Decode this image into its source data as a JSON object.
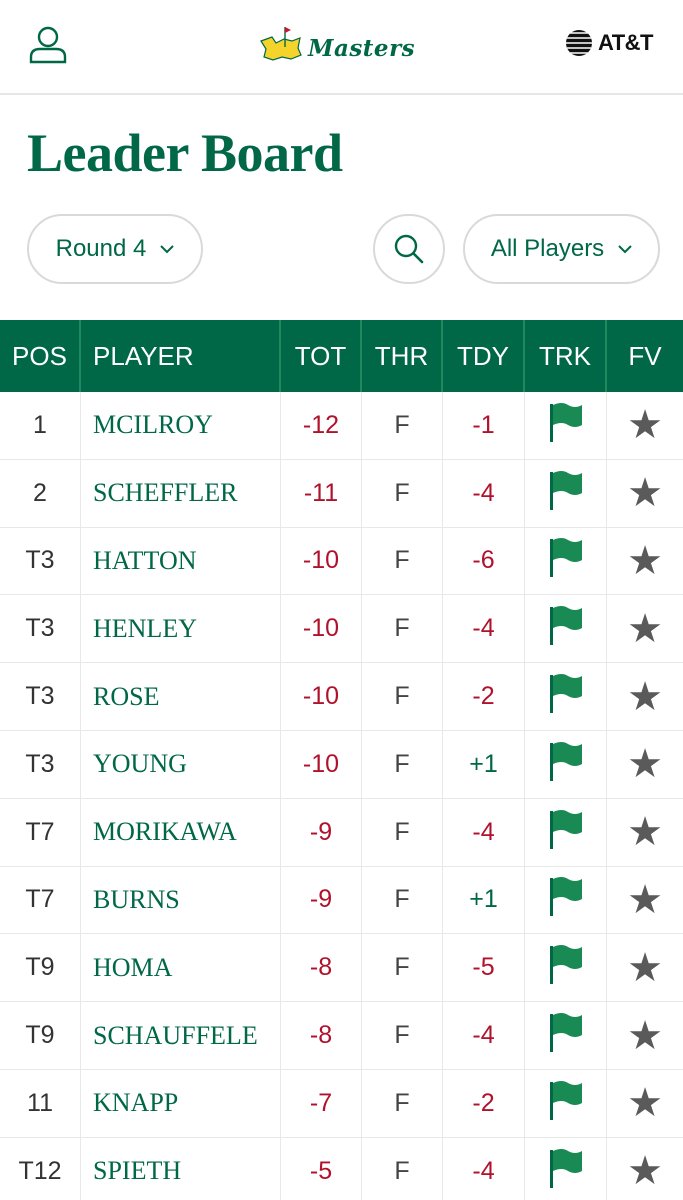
{
  "header": {
    "logo_text": "Masters",
    "sponsor_text": "AT&T"
  },
  "page_title": "Leader Board",
  "controls": {
    "round_label": "Round 4",
    "filter_label": "All Players"
  },
  "table": {
    "columns": [
      "POS",
      "PLAYER",
      "TOT",
      "THR",
      "TDY",
      "TRK",
      "FV"
    ],
    "rows": [
      {
        "pos": "1",
        "player": "MCILROY",
        "tot": "-12",
        "thr": "F",
        "tdy": "-1"
      },
      {
        "pos": "2",
        "player": "SCHEFFLER",
        "tot": "-11",
        "thr": "F",
        "tdy": "-4"
      },
      {
        "pos": "T3",
        "player": "HATTON",
        "tot": "-10",
        "thr": "F",
        "tdy": "-6"
      },
      {
        "pos": "T3",
        "player": "HENLEY",
        "tot": "-10",
        "thr": "F",
        "tdy": "-4"
      },
      {
        "pos": "T3",
        "player": "ROSE",
        "tot": "-10",
        "thr": "F",
        "tdy": "-2"
      },
      {
        "pos": "T3",
        "player": "YOUNG",
        "tot": "-10",
        "thr": "F",
        "tdy": "+1"
      },
      {
        "pos": "T7",
        "player": "MORIKAWA",
        "tot": "-9",
        "thr": "F",
        "tdy": "-4"
      },
      {
        "pos": "T7",
        "player": "BURNS",
        "tot": "-9",
        "thr": "F",
        "tdy": "+1"
      },
      {
        "pos": "T9",
        "player": "HOMA",
        "tot": "-8",
        "thr": "F",
        "tdy": "-5"
      },
      {
        "pos": "T9",
        "player": "SCHAUFFELE",
        "tot": "-8",
        "thr": "F",
        "tdy": "-4"
      },
      {
        "pos": "11",
        "player": "KNAPP",
        "tot": "-7",
        "thr": "F",
        "tdy": "-2"
      },
      {
        "pos": "T12",
        "player": "SPIETH",
        "tot": "-5",
        "thr": "F",
        "tdy": "-4"
      }
    ]
  },
  "colors": {
    "brand_green": "#006747",
    "under_par_red": "#b0122c",
    "star_gray": "#5a5a5a"
  },
  "icons": {
    "account": "user-icon",
    "search": "search-icon",
    "track": "flag-icon",
    "favorite": "star-icon"
  }
}
